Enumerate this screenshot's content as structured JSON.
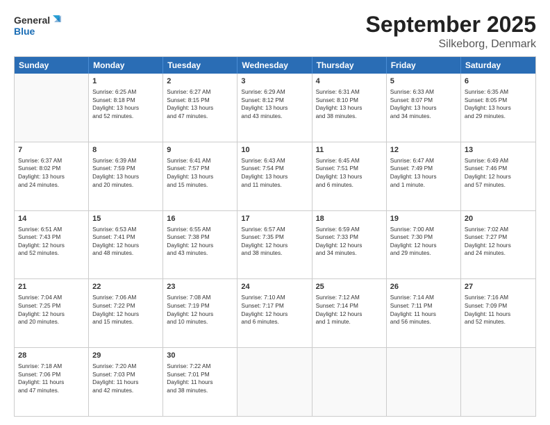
{
  "logo": {
    "line1": "General",
    "line2": "Blue"
  },
  "title": "September 2025",
  "subtitle": "Silkeborg, Denmark",
  "header_days": [
    "Sunday",
    "Monday",
    "Tuesday",
    "Wednesday",
    "Thursday",
    "Friday",
    "Saturday"
  ],
  "weeks": [
    [
      {
        "day": "",
        "content": ""
      },
      {
        "day": "1",
        "content": "Sunrise: 6:25 AM\nSunset: 8:18 PM\nDaylight: 13 hours\nand 52 minutes."
      },
      {
        "day": "2",
        "content": "Sunrise: 6:27 AM\nSunset: 8:15 PM\nDaylight: 13 hours\nand 47 minutes."
      },
      {
        "day": "3",
        "content": "Sunrise: 6:29 AM\nSunset: 8:12 PM\nDaylight: 13 hours\nand 43 minutes."
      },
      {
        "day": "4",
        "content": "Sunrise: 6:31 AM\nSunset: 8:10 PM\nDaylight: 13 hours\nand 38 minutes."
      },
      {
        "day": "5",
        "content": "Sunrise: 6:33 AM\nSunset: 8:07 PM\nDaylight: 13 hours\nand 34 minutes."
      },
      {
        "day": "6",
        "content": "Sunrise: 6:35 AM\nSunset: 8:05 PM\nDaylight: 13 hours\nand 29 minutes."
      }
    ],
    [
      {
        "day": "7",
        "content": "Sunrise: 6:37 AM\nSunset: 8:02 PM\nDaylight: 13 hours\nand 24 minutes."
      },
      {
        "day": "8",
        "content": "Sunrise: 6:39 AM\nSunset: 7:59 PM\nDaylight: 13 hours\nand 20 minutes."
      },
      {
        "day": "9",
        "content": "Sunrise: 6:41 AM\nSunset: 7:57 PM\nDaylight: 13 hours\nand 15 minutes."
      },
      {
        "day": "10",
        "content": "Sunrise: 6:43 AM\nSunset: 7:54 PM\nDaylight: 13 hours\nand 11 minutes."
      },
      {
        "day": "11",
        "content": "Sunrise: 6:45 AM\nSunset: 7:51 PM\nDaylight: 13 hours\nand 6 minutes."
      },
      {
        "day": "12",
        "content": "Sunrise: 6:47 AM\nSunset: 7:49 PM\nDaylight: 13 hours\nand 1 minute."
      },
      {
        "day": "13",
        "content": "Sunrise: 6:49 AM\nSunset: 7:46 PM\nDaylight: 12 hours\nand 57 minutes."
      }
    ],
    [
      {
        "day": "14",
        "content": "Sunrise: 6:51 AM\nSunset: 7:43 PM\nDaylight: 12 hours\nand 52 minutes."
      },
      {
        "day": "15",
        "content": "Sunrise: 6:53 AM\nSunset: 7:41 PM\nDaylight: 12 hours\nand 48 minutes."
      },
      {
        "day": "16",
        "content": "Sunrise: 6:55 AM\nSunset: 7:38 PM\nDaylight: 12 hours\nand 43 minutes."
      },
      {
        "day": "17",
        "content": "Sunrise: 6:57 AM\nSunset: 7:35 PM\nDaylight: 12 hours\nand 38 minutes."
      },
      {
        "day": "18",
        "content": "Sunrise: 6:59 AM\nSunset: 7:33 PM\nDaylight: 12 hours\nand 34 minutes."
      },
      {
        "day": "19",
        "content": "Sunrise: 7:00 AM\nSunset: 7:30 PM\nDaylight: 12 hours\nand 29 minutes."
      },
      {
        "day": "20",
        "content": "Sunrise: 7:02 AM\nSunset: 7:27 PM\nDaylight: 12 hours\nand 24 minutes."
      }
    ],
    [
      {
        "day": "21",
        "content": "Sunrise: 7:04 AM\nSunset: 7:25 PM\nDaylight: 12 hours\nand 20 minutes."
      },
      {
        "day": "22",
        "content": "Sunrise: 7:06 AM\nSunset: 7:22 PM\nDaylight: 12 hours\nand 15 minutes."
      },
      {
        "day": "23",
        "content": "Sunrise: 7:08 AM\nSunset: 7:19 PM\nDaylight: 12 hours\nand 10 minutes."
      },
      {
        "day": "24",
        "content": "Sunrise: 7:10 AM\nSunset: 7:17 PM\nDaylight: 12 hours\nand 6 minutes."
      },
      {
        "day": "25",
        "content": "Sunrise: 7:12 AM\nSunset: 7:14 PM\nDaylight: 12 hours\nand 1 minute."
      },
      {
        "day": "26",
        "content": "Sunrise: 7:14 AM\nSunset: 7:11 PM\nDaylight: 11 hours\nand 56 minutes."
      },
      {
        "day": "27",
        "content": "Sunrise: 7:16 AM\nSunset: 7:09 PM\nDaylight: 11 hours\nand 52 minutes."
      }
    ],
    [
      {
        "day": "28",
        "content": "Sunrise: 7:18 AM\nSunset: 7:06 PM\nDaylight: 11 hours\nand 47 minutes."
      },
      {
        "day": "29",
        "content": "Sunrise: 7:20 AM\nSunset: 7:03 PM\nDaylight: 11 hours\nand 42 minutes."
      },
      {
        "day": "30",
        "content": "Sunrise: 7:22 AM\nSunset: 7:01 PM\nDaylight: 11 hours\nand 38 minutes."
      },
      {
        "day": "",
        "content": ""
      },
      {
        "day": "",
        "content": ""
      },
      {
        "day": "",
        "content": ""
      },
      {
        "day": "",
        "content": ""
      }
    ]
  ]
}
